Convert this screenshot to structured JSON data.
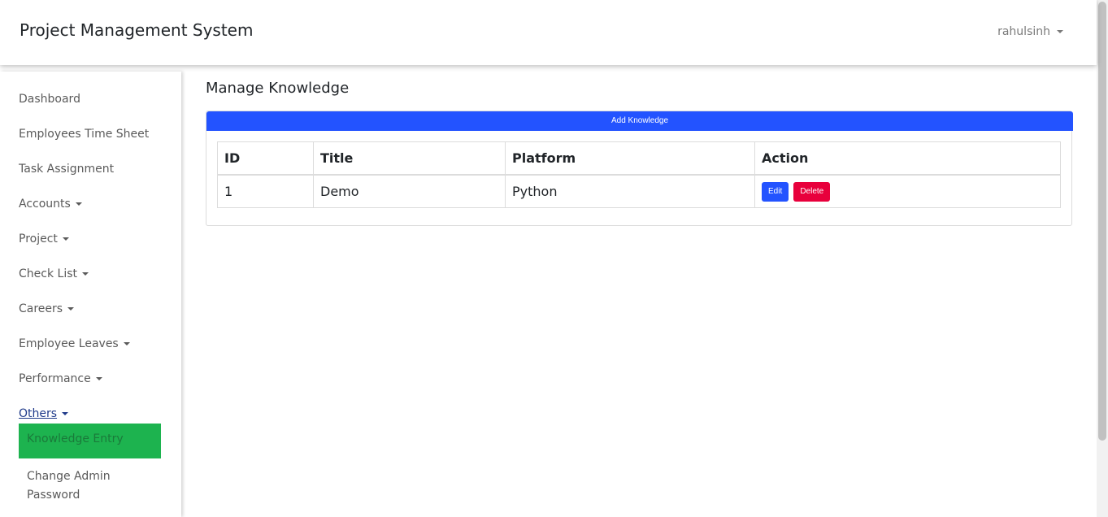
{
  "navbar": {
    "brand": "Project Management System",
    "user": "rahulsinh"
  },
  "sidebar": {
    "items": [
      {
        "label": "Dashboard",
        "dropdown": false
      },
      {
        "label": "Employees Time Sheet",
        "dropdown": false
      },
      {
        "label": "Task Assignment",
        "dropdown": false
      },
      {
        "label": "Accounts",
        "dropdown": true
      },
      {
        "label": "Project",
        "dropdown": true
      },
      {
        "label": "Check List",
        "dropdown": true
      },
      {
        "label": "Careers",
        "dropdown": true
      },
      {
        "label": "Employee Leaves",
        "dropdown": true
      },
      {
        "label": "Performance",
        "dropdown": true
      },
      {
        "label": "Others",
        "dropdown": true
      }
    ],
    "submenu": {
      "active": "Knowledge Entry",
      "other": "Change Admin Password"
    }
  },
  "main": {
    "title": "Manage Knowledge",
    "add_button": "Add Knowledge",
    "table": {
      "headers": [
        "ID",
        "Title",
        "Platform",
        "Action"
      ],
      "rows": [
        {
          "id": "1",
          "title": "Demo",
          "platform": "Python"
        }
      ],
      "edit_label": "Edit",
      "delete_label": "Delete"
    }
  },
  "colors": {
    "primary": "#2353ff",
    "danger": "#e8003c",
    "active": "#1db34f"
  }
}
